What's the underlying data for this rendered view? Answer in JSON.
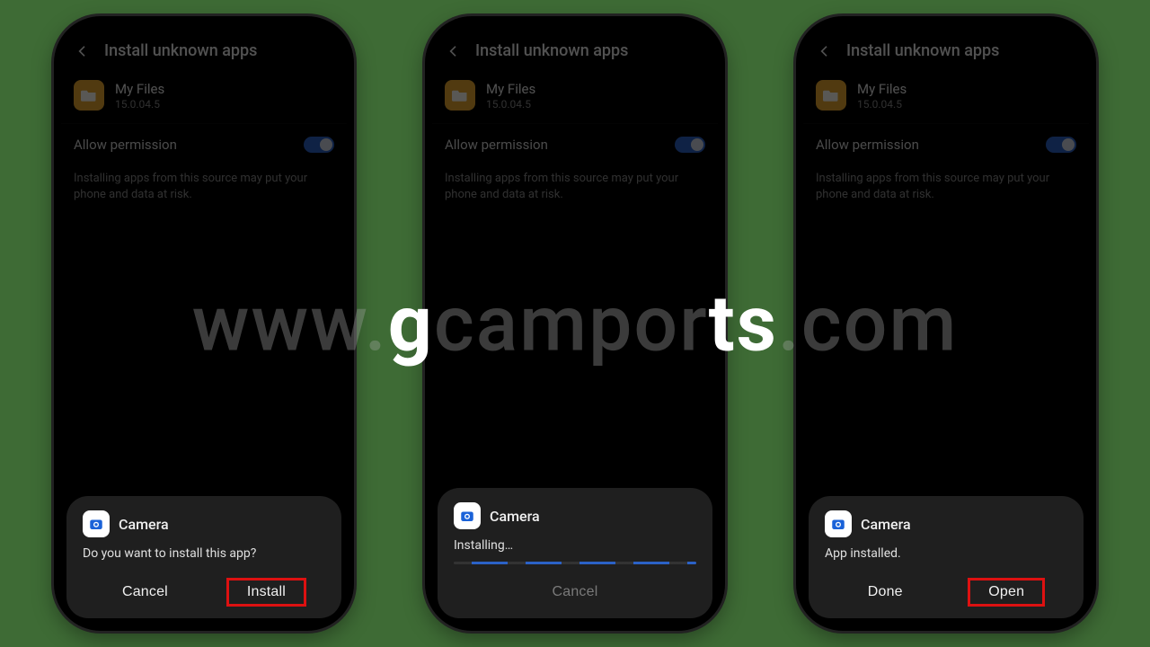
{
  "header": {
    "title": "Install unknown apps"
  },
  "source_app": {
    "name": "My Files",
    "version": "15.0.04.5"
  },
  "permission": {
    "label": "Allow permission",
    "description": "Installing apps from this source may put your phone and data at risk."
  },
  "dialog": {
    "app_name": "Camera",
    "prompt_msg": "Do you want to install this app?",
    "installing_msg": "Installing…",
    "installed_msg": "App installed.",
    "cancel": "Cancel",
    "install": "Install",
    "done": "Done",
    "open": "Open"
  },
  "watermark": {
    "pre": "www.",
    "mid1": "g",
    "mid2": "campor",
    "mid3": "ts",
    "post": ".com"
  }
}
